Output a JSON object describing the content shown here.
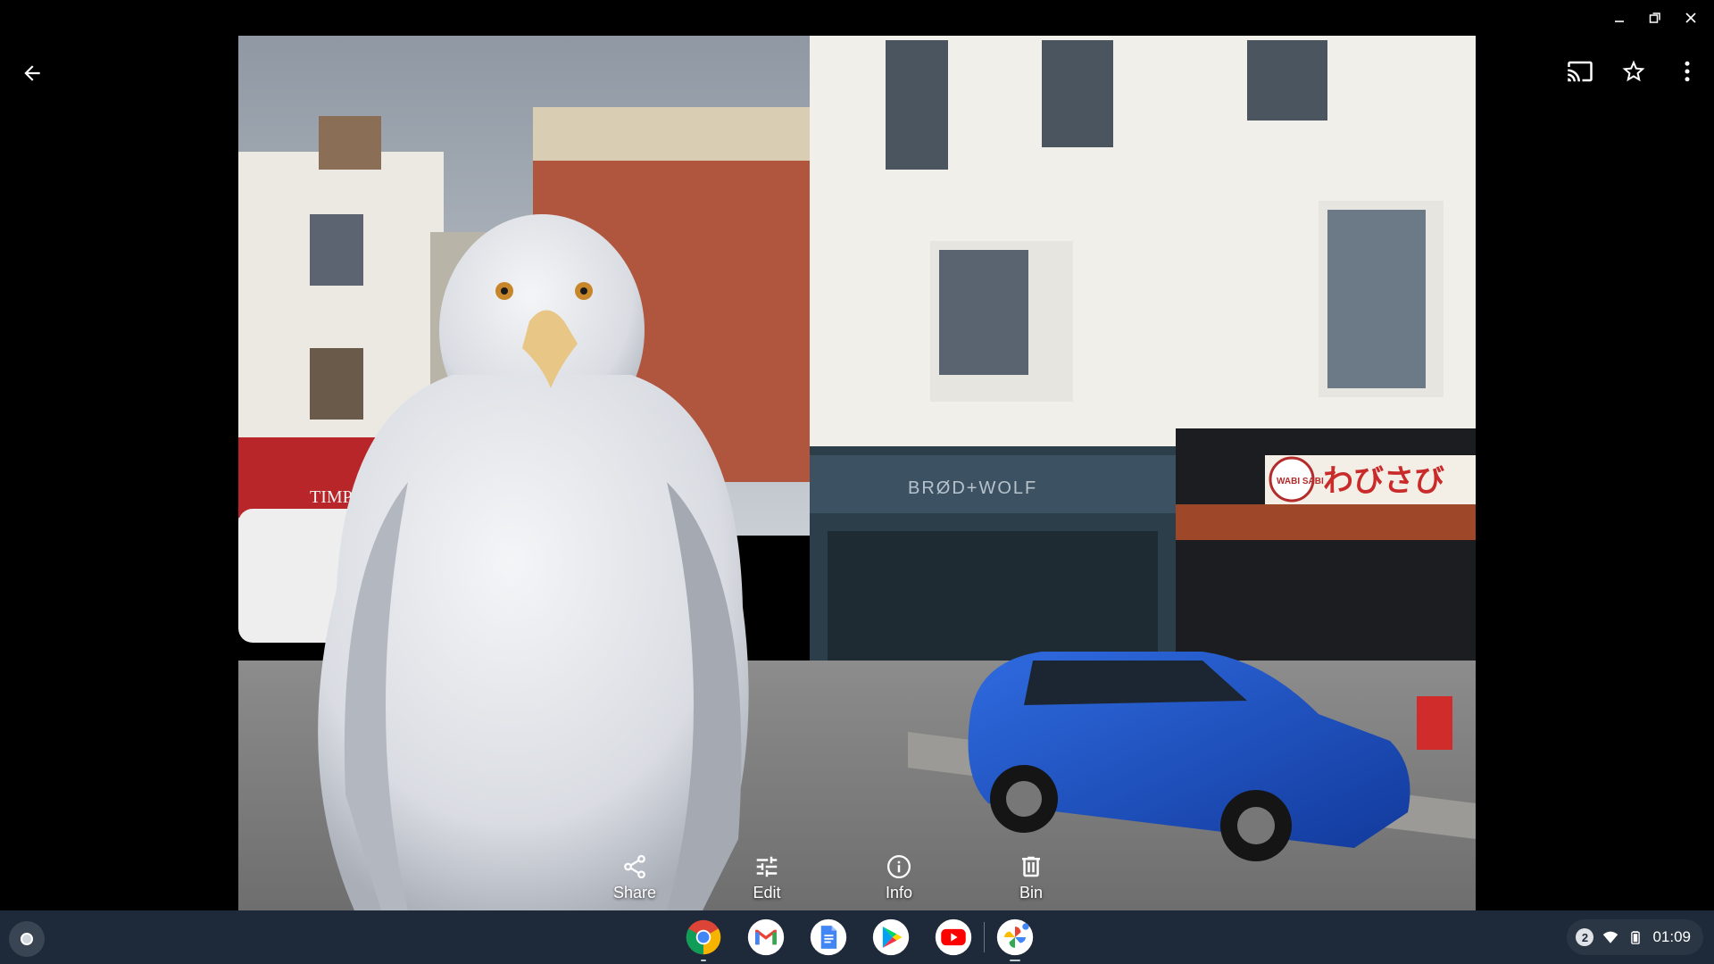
{
  "window": {
    "controls": [
      "minimize",
      "restore",
      "close"
    ]
  },
  "toolbar": {
    "back_icon": "arrow-back-icon",
    "cast_icon": "cast-icon",
    "favorite_icon": "star-outline-icon",
    "more_icon": "more-vert-icon"
  },
  "photo": {
    "sign_store": "BRØD+WOLF",
    "sign_shop": "TIMPSON",
    "sign_restaurant_logo": "WABI SABI",
    "sign_restaurant": "わびさび"
  },
  "actions": [
    {
      "label": "Share",
      "icon": "share-icon"
    },
    {
      "label": "Edit",
      "icon": "tune-icon"
    },
    {
      "label": "Info",
      "icon": "info-icon"
    },
    {
      "label": "Bin",
      "icon": "trash-icon"
    }
  ],
  "shelf": {
    "apps": [
      {
        "name": "Chrome",
        "icon": "chrome-icon"
      },
      {
        "name": "Gmail",
        "icon": "gmail-icon"
      },
      {
        "name": "Docs",
        "icon": "docs-icon"
      },
      {
        "name": "Play Store",
        "icon": "play-store-icon"
      },
      {
        "name": "YouTube",
        "icon": "youtube-icon"
      },
      {
        "name": "Photos",
        "icon": "photos-icon"
      }
    ],
    "notification_count": "2",
    "time": "01:09"
  }
}
